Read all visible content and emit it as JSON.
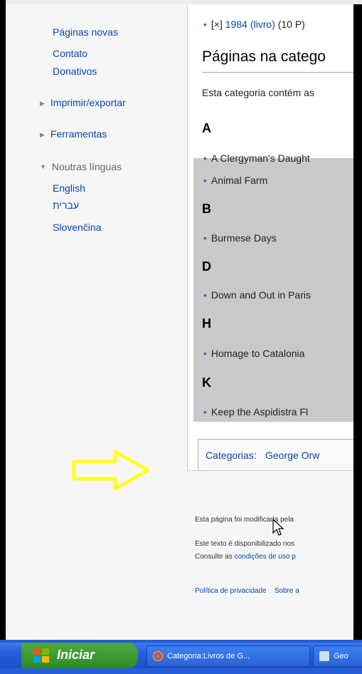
{
  "sidebar": {
    "links_top": [
      "Páginas novas",
      "Contato",
      "Donativos"
    ],
    "print_export": "Imprimir/exportar",
    "tools": "Ferramentas",
    "languages_label": "Noutras línguas",
    "languages": [
      "English",
      "עברית",
      "Slovenčina"
    ]
  },
  "content": {
    "top_item_prefix": "[×]",
    "top_item_link": "1984",
    "top_item_link2": "(livro)",
    "top_item_suffix": "(10 P)",
    "section_heading": "Páginas na catego",
    "intro": "Esta categoria contém as",
    "groups": [
      {
        "letter": "A",
        "items": [
          "A Clergyman's Daught",
          "Animal Farm"
        ]
      },
      {
        "letter": "B",
        "items": [
          "Burmese Days"
        ]
      },
      {
        "letter": "D",
        "items": [
          "Down and Out in Paris"
        ]
      },
      {
        "letter": "H",
        "items": [
          "Homage to Catalonia"
        ]
      },
      {
        "letter": "K",
        "items": [
          "Keep the Aspidistra Fl"
        ]
      }
    ],
    "categories_label": "Categorias:",
    "categories_value": "George Orw"
  },
  "footer": {
    "modified": "Esta página foi modificada pela",
    "license": "Este texto é disponibilizado nos",
    "consult_prefix": "Consulte as",
    "consult_link": "condições de uso p",
    "privacy": "Política de privacidade",
    "about": "Sobre a"
  },
  "taskbar": {
    "start_label": "Iniciar",
    "task1": "Categoria:Livros de G...",
    "task2": "Geo"
  },
  "colors": {
    "link": "#0645ad",
    "annotation_arrow": "#ffff22",
    "taskbar": "#245edc",
    "start": "#3a9a32"
  }
}
